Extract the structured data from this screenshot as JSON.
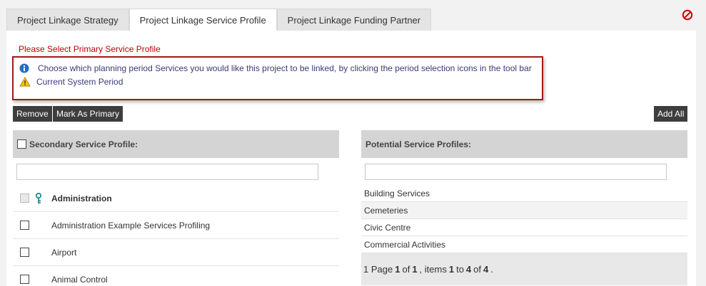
{
  "tabs": [
    {
      "label": "Project Linkage Strategy",
      "active": false
    },
    {
      "label": "Project Linkage Service Profile",
      "active": true
    },
    {
      "label": "Project Linkage Funding Partner",
      "active": false
    }
  ],
  "warning_text": "Please Select Primary Service Profile",
  "messages": {
    "info": "Choose which planning period Services you would like this project to be linked, by clicking the period selection icons in the tool bar",
    "period": "Current System Period"
  },
  "toolbar": {
    "remove_label": "Remove",
    "mark_primary_label": "Mark As Primary",
    "add_all_label": "Add All"
  },
  "secondary": {
    "header": "Secondary Service Profile:",
    "filter_value": "",
    "items": [
      {
        "label": "Administration",
        "primary": true
      },
      {
        "label": "Administration Example Services Profiling",
        "primary": false
      },
      {
        "label": "Airport",
        "primary": false
      },
      {
        "label": "Animal Control",
        "primary": false
      }
    ]
  },
  "potential": {
    "header": "Potential Service Profiles:",
    "filter_value": "",
    "items": [
      "Building Services",
      "Cemeteries",
      "Civic Centre",
      "Commercial Activities"
    ],
    "pager": {
      "page_icon": "1",
      "page_word": "Page",
      "page": "1",
      "of_word": "of",
      "pages": "1",
      "items_word": ", items",
      "from": "1",
      "to_word": "to",
      "to": "4",
      "of2": "of",
      "total": "4",
      "end": "."
    }
  },
  "colors": {
    "warning": "#c00000",
    "msg_border": "#a01a1a",
    "button": "#3d3d3d"
  },
  "icons": [
    "close-icon",
    "info-icon",
    "warning-icon",
    "key-icon"
  ]
}
